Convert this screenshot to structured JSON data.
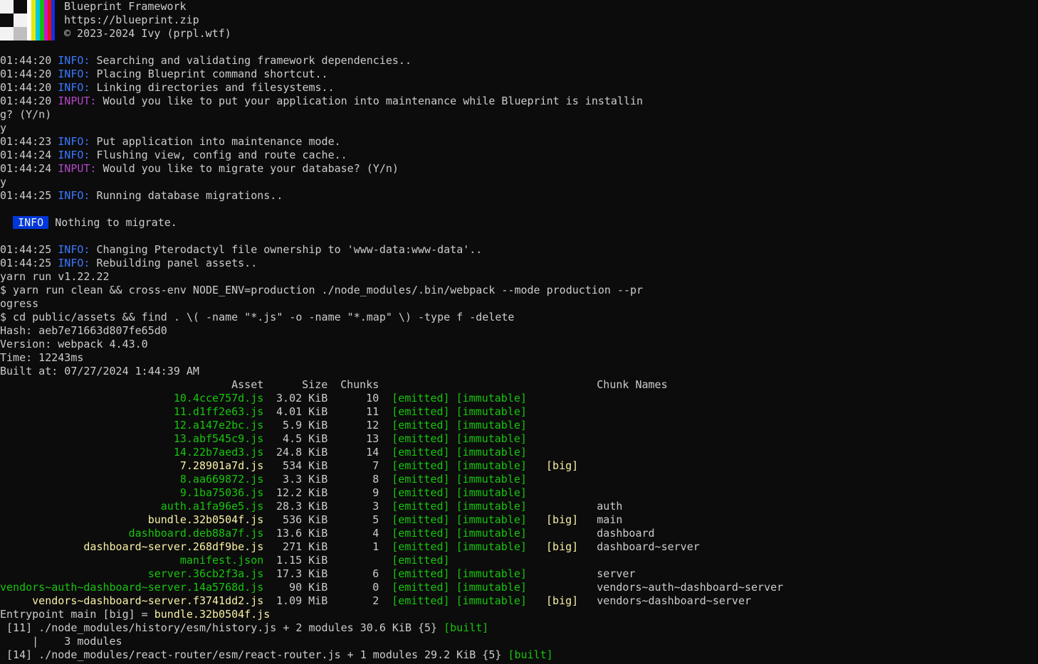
{
  "header": {
    "title": "Blueprint Framework",
    "url": "https://blueprint.zip",
    "copyright": "© 2023-2024 Ivy (prpl.wtf)"
  },
  "log": [
    {
      "time": "01:44:20",
      "level": "INFO:",
      "msg": "Searching and validating framework dependencies.."
    },
    {
      "time": "01:44:20",
      "level": "INFO:",
      "msg": "Placing Blueprint command shortcut.."
    },
    {
      "time": "01:44:20",
      "level": "INFO:",
      "msg": "Linking directories and filesystems.."
    },
    {
      "time": "01:44:20",
      "level": "INPUT:",
      "msg": "Would you like to put your application into maintenance while Blueprint is installin"
    }
  ],
  "wrap1": "g? (Y/n)",
  "answer1": "y",
  "log2": [
    {
      "time": "01:44:23",
      "level": "INFO:",
      "msg": "Put application into maintenance mode."
    },
    {
      "time": "01:44:24",
      "level": "INFO:",
      "msg": "Flushing view, config and route cache.."
    },
    {
      "time": "01:44:24",
      "level": "INPUT:",
      "msg": "Would you like to migrate your database? (Y/n)"
    }
  ],
  "answer2": "y",
  "log3": {
    "time": "01:44:25",
    "level": "INFO:",
    "msg": "Running database migrations.."
  },
  "badge": {
    "label": "INFO",
    "msg": "Nothing to migrate."
  },
  "log4": [
    {
      "time": "01:44:25",
      "level": "INFO:",
      "msg": "Changing Pterodactyl file ownership to 'www-data:www-data'.."
    },
    {
      "time": "01:44:25",
      "level": "INFO:",
      "msg": "Rebuilding panel assets.."
    }
  ],
  "yarn": "yarn run v1.22.22",
  "cmd1": "$ yarn run clean && cross-env NODE_ENV=production ./node_modules/.bin/webpack --mode production --pr",
  "cmd1_wrap": "ogress",
  "cmd2": "$ cd public/assets && find . \\( -name \"*.js\" -o -name \"*.map\" \\) -type f -delete",
  "hash": "Hash: aeb7e71663d807fe65d0",
  "version": "Version: webpack 4.43.0",
  "time": "Time: 12243ms",
  "built": "Built at: 07/27/2024 1:44:39 AM",
  "table": {
    "headers": {
      "asset": "Asset",
      "size": "Size",
      "chunks": "Chunks",
      "names": "Chunk Names"
    },
    "rows": [
      {
        "asset": "10.4cce757d.js",
        "size": "3.02 KiB",
        "chunks": "10",
        "emitted": "[emitted]",
        "immutable": "[immutable]",
        "big": "",
        "names": "",
        "color": "green"
      },
      {
        "asset": "11.d1ff2e63.js",
        "size": "4.01 KiB",
        "chunks": "11",
        "emitted": "[emitted]",
        "immutable": "[immutable]",
        "big": "",
        "names": "",
        "color": "green"
      },
      {
        "asset": "12.a147e2bc.js",
        "size": "5.9 KiB",
        "chunks": "12",
        "emitted": "[emitted]",
        "immutable": "[immutable]",
        "big": "",
        "names": "",
        "color": "green"
      },
      {
        "asset": "13.abf545c9.js",
        "size": "4.5 KiB",
        "chunks": "13",
        "emitted": "[emitted]",
        "immutable": "[immutable]",
        "big": "",
        "names": "",
        "color": "green"
      },
      {
        "asset": "14.22b7aed3.js",
        "size": "24.8 KiB",
        "chunks": "14",
        "emitted": "[emitted]",
        "immutable": "[immutable]",
        "big": "",
        "names": "",
        "color": "green"
      },
      {
        "asset": "7.28901a7d.js",
        "size": "534 KiB",
        "chunks": "7",
        "emitted": "[emitted]",
        "immutable": "[immutable]",
        "big": "[big]",
        "names": "",
        "color": "yellow"
      },
      {
        "asset": "8.aa669872.js",
        "size": "3.3 KiB",
        "chunks": "8",
        "emitted": "[emitted]",
        "immutable": "[immutable]",
        "big": "",
        "names": "",
        "color": "green"
      },
      {
        "asset": "9.1ba75036.js",
        "size": "12.2 KiB",
        "chunks": "9",
        "emitted": "[emitted]",
        "immutable": "[immutable]",
        "big": "",
        "names": "",
        "color": "green"
      },
      {
        "asset": "auth.a1fa96e5.js",
        "size": "28.3 KiB",
        "chunks": "3",
        "emitted": "[emitted]",
        "immutable": "[immutable]",
        "big": "",
        "names": "auth",
        "color": "green"
      },
      {
        "asset": "bundle.32b0504f.js",
        "size": "536 KiB",
        "chunks": "5",
        "emitted": "[emitted]",
        "immutable": "[immutable]",
        "big": "[big]",
        "names": "main",
        "color": "yellow"
      },
      {
        "asset": "dashboard.deb88a7f.js",
        "size": "13.6 KiB",
        "chunks": "4",
        "emitted": "[emitted]",
        "immutable": "[immutable]",
        "big": "",
        "names": "dashboard",
        "color": "green"
      },
      {
        "asset": "dashboard~server.268df9be.js",
        "size": "271 KiB",
        "chunks": "1",
        "emitted": "[emitted]",
        "immutable": "[immutable]",
        "big": "[big]",
        "names": "dashboard~server",
        "color": "yellow"
      },
      {
        "asset": "manifest.json",
        "size": "1.15 KiB",
        "chunks": "",
        "emitted": "[emitted]",
        "immutable": "",
        "big": "",
        "names": "",
        "color": "green"
      },
      {
        "asset": "server.36cb2f3a.js",
        "size": "17.3 KiB",
        "chunks": "6",
        "emitted": "[emitted]",
        "immutable": "[immutable]",
        "big": "",
        "names": "server",
        "color": "green"
      },
      {
        "asset": "vendors~auth~dashboard~server.14a5768d.js",
        "size": "90 KiB",
        "chunks": "0",
        "emitted": "[emitted]",
        "immutable": "[immutable]",
        "big": "",
        "names": "vendors~auth~dashboard~server",
        "color": "green"
      },
      {
        "asset": "vendors~dashboard~server.f3741dd2.js",
        "size": "1.09 MiB",
        "chunks": "2",
        "emitted": "[emitted]",
        "immutable": "[immutable]",
        "big": "[big]",
        "names": "vendors~dashboard~server",
        "color": "yellow"
      }
    ]
  },
  "entrypoint": {
    "prefix": "Entrypoint main [big] = ",
    "file": "bundle.32b0504f.js"
  },
  "modules": [
    {
      "text": " [11] ./node_modules/history/esm/history.js + 2 modules 30.6 KiB {5} ",
      "tag": "[built]"
    },
    {
      "text": "     |    3 modules",
      "tag": ""
    },
    {
      "text": " [14] ./node_modules/react-router/esm/react-router.js + 1 modules 29.2 KiB {5} ",
      "tag": "[built]"
    }
  ],
  "colors": {
    "background": "#0c0c0c",
    "text": "#cccccc",
    "info": "#3b78ff",
    "input": "#b148c6",
    "green": "#16c60c",
    "yellow": "#f9f1a5",
    "badge": "#0037da"
  }
}
